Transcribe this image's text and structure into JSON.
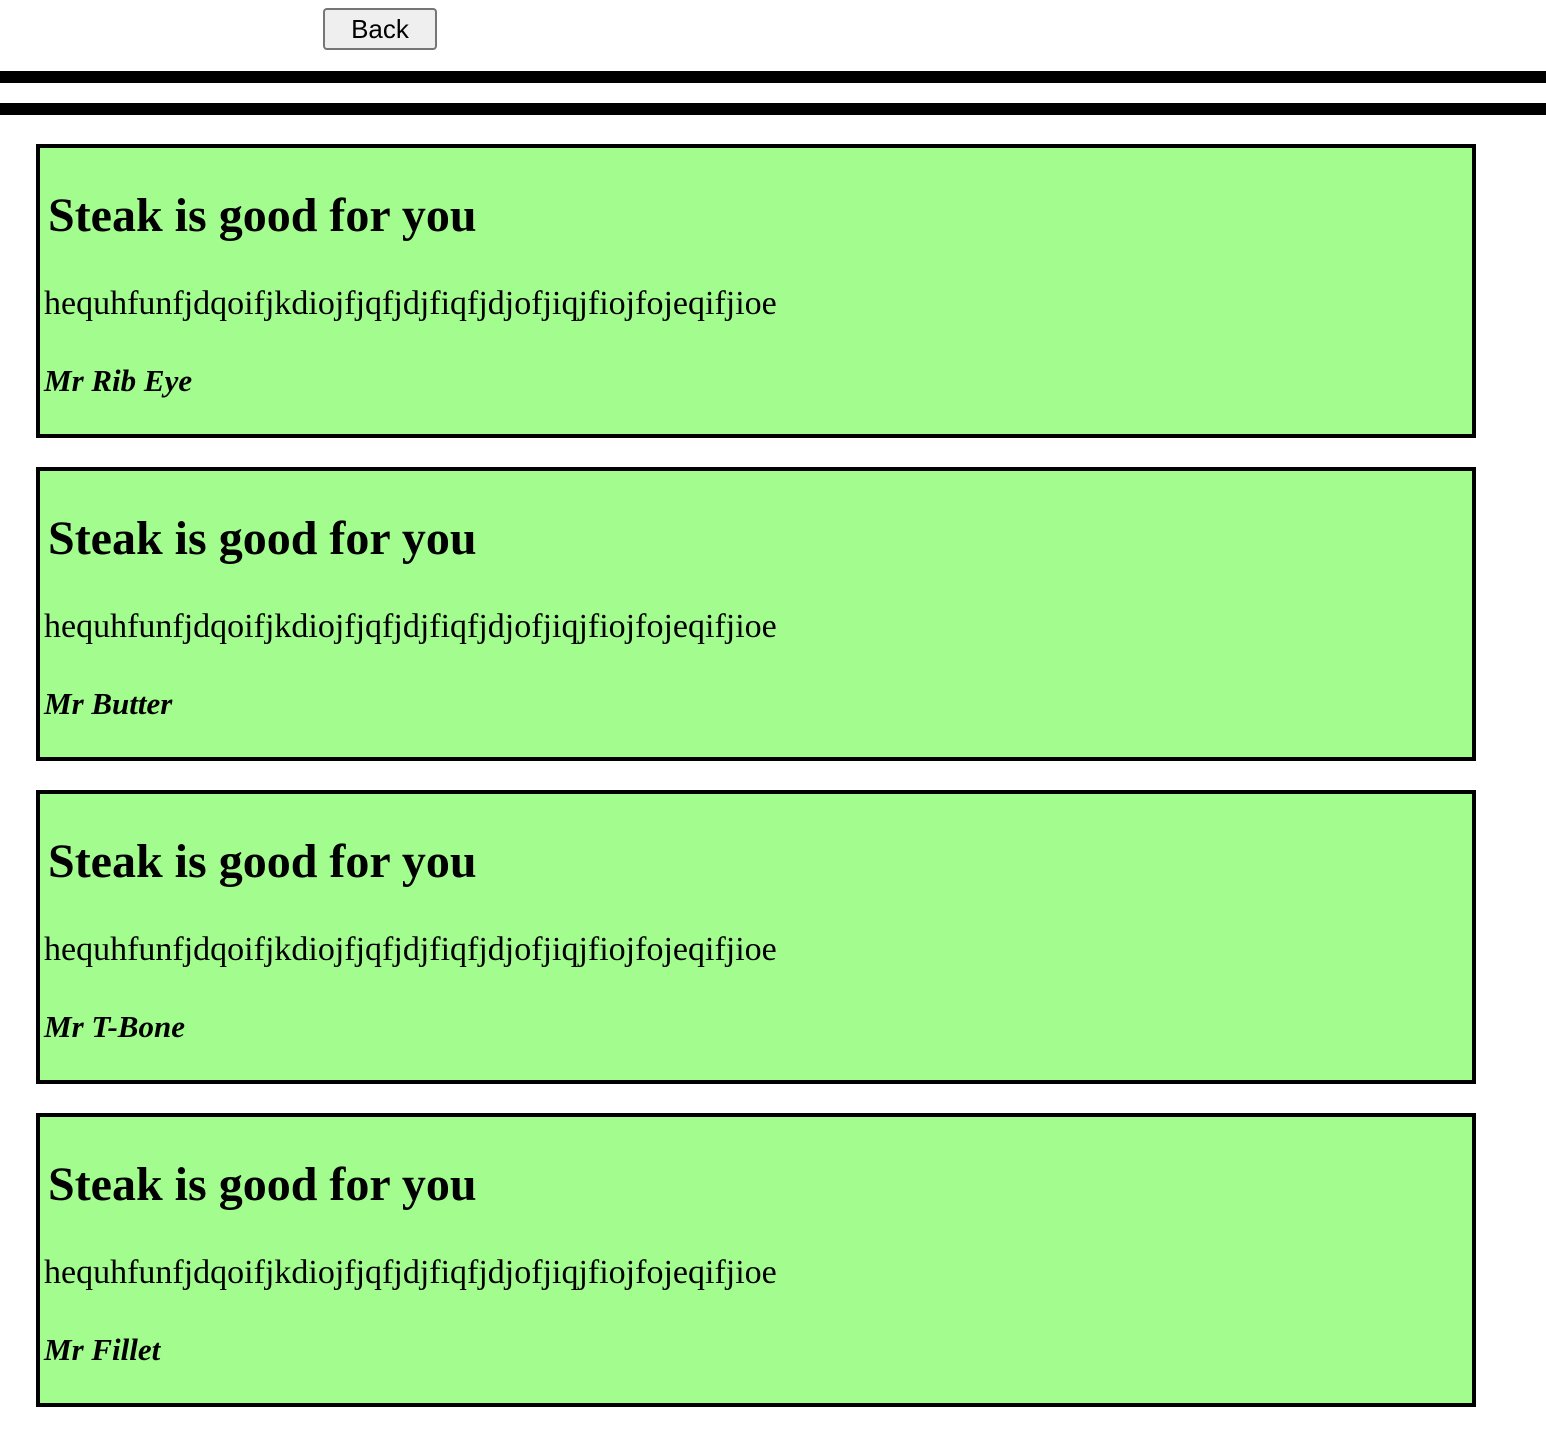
{
  "toolbar": {
    "back_label": "Back"
  },
  "posts": [
    {
      "title": "Steak is good for you",
      "body": "hequhfunfjdqoifjkdiojfjqfjdjfiqfjdjofjiqjfiojfojeqifjioe",
      "author": "Mr Rib Eye"
    },
    {
      "title": "Steak is good for you",
      "body": "hequhfunfjdqoifjkdiojfjqfjdjfiqfjdjofjiqjfiojfojeqifjioe",
      "author": "Mr Butter"
    },
    {
      "title": "Steak is good for you",
      "body": "hequhfunfjdqoifjkdiojfjqfjdjfiqfjdjofjiqjfiojfojeqifjioe",
      "author": "Mr T-Bone"
    },
    {
      "title": "Steak is good for you",
      "body": "hequhfunfjdqoifjkdiojfjqfjdjfiqfjdjofjiqjfiojfojeqifjioe",
      "author": "Mr Fillet"
    }
  ],
  "colors": {
    "card_background": "#a3fc8e",
    "card_border": "#000000",
    "divider": "#000000"
  }
}
